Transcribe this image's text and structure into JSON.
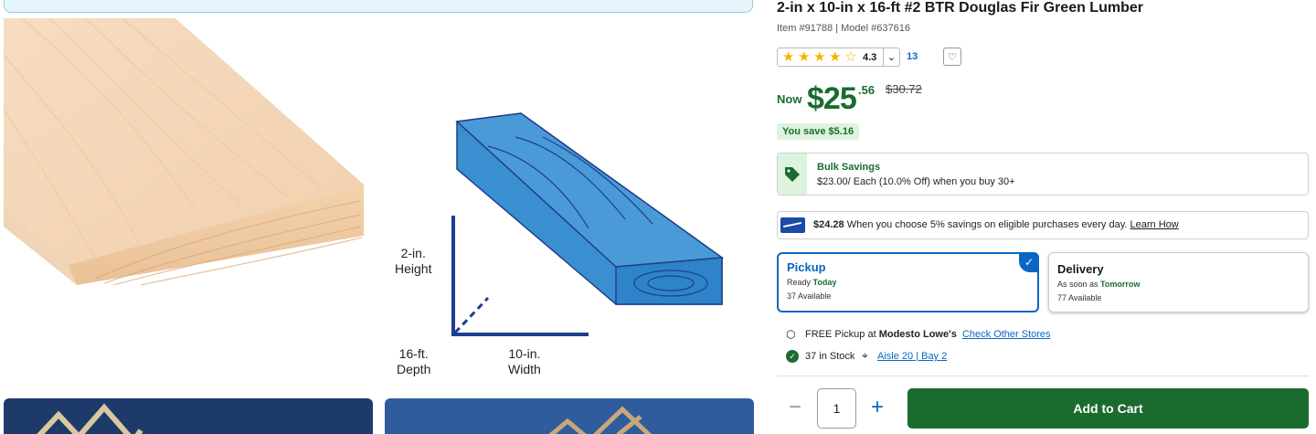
{
  "product": {
    "title": "2-in x 10-in x 16-ft #2 BTR Douglas Fir Green Lumber",
    "item_line": "Item #91788 | Model #637616",
    "rating": "4.3",
    "rating_stars_value": 4.3,
    "review_count": "13"
  },
  "price": {
    "now_label": "Now",
    "dollars": "$25",
    "cents": ".56",
    "was": "$30.72",
    "savings": "You save $5.16"
  },
  "bulk": {
    "title": "Bulk Savings",
    "text": "$23.00/ Each (10.0% Off) when you buy 30+"
  },
  "card_offer": {
    "amount": "$24.28",
    "text": " When you choose 5% savings on eligible purchases every day. ",
    "link": "Learn How"
  },
  "fulfillment": {
    "pickup": {
      "title": "Pickup",
      "line1_prefix": "Ready ",
      "line1_highlight": "Today",
      "line2": "37 Available"
    },
    "delivery": {
      "title": "Delivery",
      "line1_prefix": "As soon as ",
      "line1_highlight": "Tomorrow",
      "line2": "77 Available"
    }
  },
  "store": {
    "free_pickup_prefix": "FREE Pickup at ",
    "store_name": "Modesto Lowe's",
    "check_other": "Check Other Stores",
    "stock": "37 in Stock",
    "aisle": "Aisle 20 | Bay 2"
  },
  "cart": {
    "quantity": "1",
    "minus": "−",
    "plus": "+",
    "add_label": "Add to Cart"
  },
  "diagram": {
    "height_label": "2-in.\nHeight",
    "depth_label": "16-ft.\nDepth",
    "width_label": "10-in.\nWidth"
  },
  "colors": {
    "brand_green": "#1b6b2f",
    "link_blue": "#0b66c3",
    "diagram_blue": "#3a8fd1"
  }
}
